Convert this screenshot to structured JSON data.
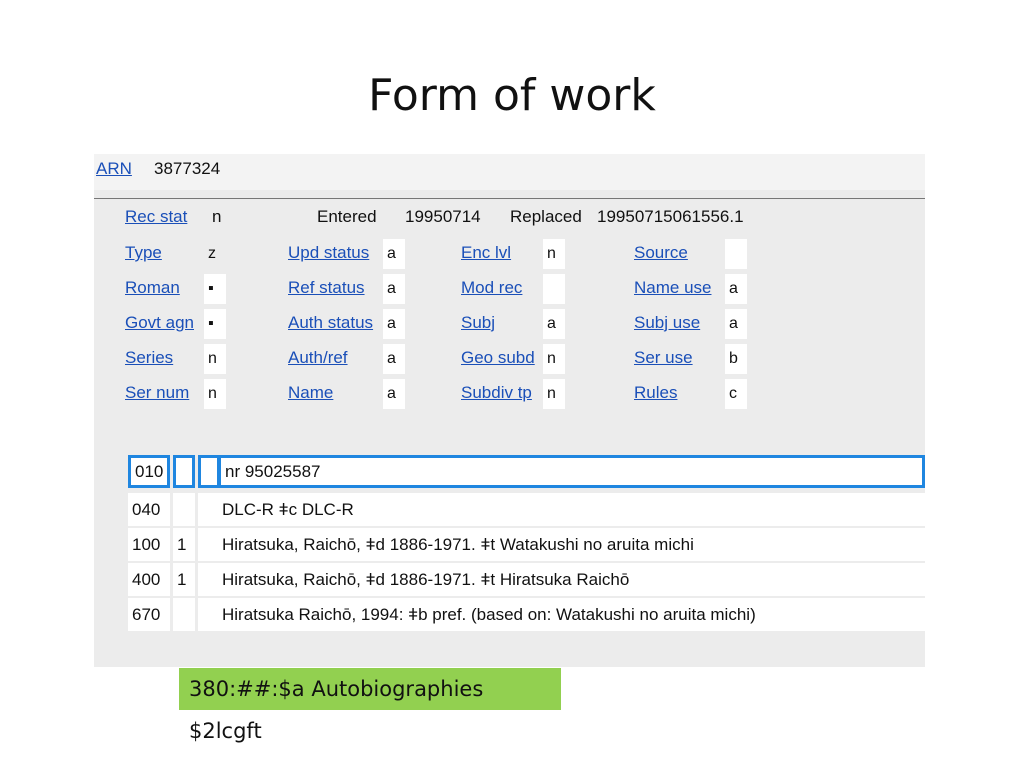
{
  "title": "Form of work",
  "arn": {
    "label": "ARN",
    "value": "3877324"
  },
  "header": {
    "rec_stat_label": "Rec stat",
    "rec_stat_value": "n",
    "entered_label": "Entered",
    "entered_value": "19950714",
    "replaced_label": "Replaced",
    "replaced_value": "19950715061556.1"
  },
  "fixed_fields": {
    "type": {
      "label": "Type",
      "value": "z"
    },
    "roman": {
      "label": "Roman",
      "value": "▪"
    },
    "govt_agn": {
      "label": "Govt agn",
      "value": "▪"
    },
    "series": {
      "label": "Series",
      "value": "n"
    },
    "ser_num": {
      "label": "Ser num",
      "value": "n"
    },
    "upd_status": {
      "label": "Upd status",
      "value": "a"
    },
    "ref_status": {
      "label": "Ref status",
      "value": "a"
    },
    "auth_status": {
      "label": "Auth status",
      "value": "a"
    },
    "auth_ref": {
      "label": "Auth/ref",
      "value": "a"
    },
    "name": {
      "label": "Name",
      "value": "a"
    },
    "enc_lvl": {
      "label": "Enc lvl",
      "value": "n"
    },
    "mod_rec": {
      "label": "Mod rec",
      "value": ""
    },
    "subj": {
      "label": "Subj",
      "value": "a"
    },
    "geo_subd": {
      "label": "Geo subd",
      "value": "n"
    },
    "subdiv_tp": {
      "label": "Subdiv tp",
      "value": "n"
    },
    "source": {
      "label": "Source",
      "value": ""
    },
    "name_use": {
      "label": "Name use",
      "value": "a"
    },
    "subj_use": {
      "label": "Subj use",
      "value": "a"
    },
    "ser_use": {
      "label": "Ser use",
      "value": "b"
    },
    "rules": {
      "label": "Rules",
      "value": "c"
    }
  },
  "fields": [
    {
      "tag": "010",
      "ind1": "",
      "ind2": "",
      "content": "nr 95025587"
    },
    {
      "tag": "040",
      "ind1": "",
      "ind2": "",
      "content": "DLC-R ǂc DLC-R"
    },
    {
      "tag": "100",
      "ind1": "1",
      "ind2": "",
      "content": "Hiratsuka, Raichō, ǂd 1886-1971. ǂt Watakushi no aruita michi"
    },
    {
      "tag": "400",
      "ind1": "1",
      "ind2": "",
      "content": "Hiratsuka, Raichō, ǂd 1886-1971. ǂt Hiratsuka Raichō"
    },
    {
      "tag": "670",
      "ind1": "",
      "ind2": "",
      "content": "Hiratsuka Raichō, 1994: ǂb pref. (based on: Watakushi no aruita michi)"
    }
  ],
  "callout": "380:##:$a Autobiographies $2lcgft",
  "colors": {
    "link": "#1a4fb8",
    "selection": "#1f86e0",
    "callout_bg": "#92d050",
    "panel_bg": "#ececec"
  }
}
